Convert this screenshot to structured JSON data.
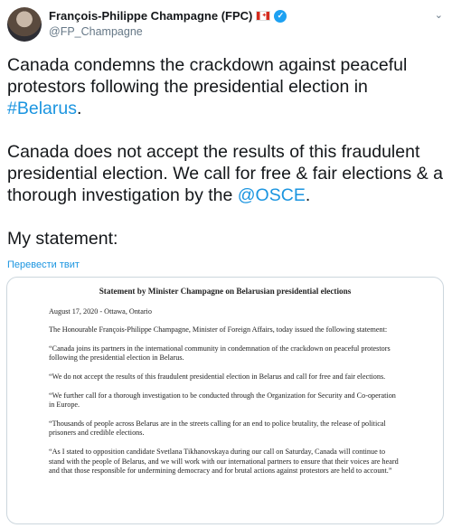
{
  "author": {
    "display_name": "François-Philippe Champagne (FPC)",
    "handle": "@FP_Champagne",
    "flag_icon": "canada-flag-icon",
    "verified_icon": "verified-badge-icon"
  },
  "tweet": {
    "p1_text": "Canada condemns the crackdown against peaceful protestors following the presidential election in ",
    "p1_hashtag": "#Belarus",
    "p1_end": ".",
    "p2_text": "Canada does not accept the results of this fraudulent presidential election. We call for free & fair elections & a thorough investigation by the ",
    "p2_mention": "@OSCE",
    "p2_end": ".",
    "p3_text": "My statement:"
  },
  "translate_label": "Перевести твит",
  "document": {
    "title": "Statement by Minister Champagne on Belarusian presidential elections",
    "dateline": "August 17, 2020 - Ottawa, Ontario",
    "paragraphs": [
      "The Honourable François-Philippe Champagne, Minister of Foreign Affairs, today issued the following statement:",
      "“Canada joins its partners in the international community in condemnation of the crackdown on peaceful protestors following the presidential election in Belarus.",
      "“We do not accept the results of this fraudulent presidential election in Belarus and call for free and fair elections.",
      "“We further call for a thorough investigation to be conducted through the Organization for Security and Co-operation in Europe.",
      "“Thousands of people across Belarus are in the streets calling for an end to police brutality, the release of political prisoners and credible elections.",
      "“As I stated to opposition candidate Svetlana Tikhanovskaya during our call on Saturday, Canada will continue to stand with the people of Belarus, and we will work with our international partners to ensure that their voices are heard and that those responsible for undermining democracy and for brutal actions against protestors are held to account.”"
    ]
  },
  "colors": {
    "link": "#1b95e0",
    "verified": "#1da1f2",
    "secondary_text": "#657786"
  }
}
